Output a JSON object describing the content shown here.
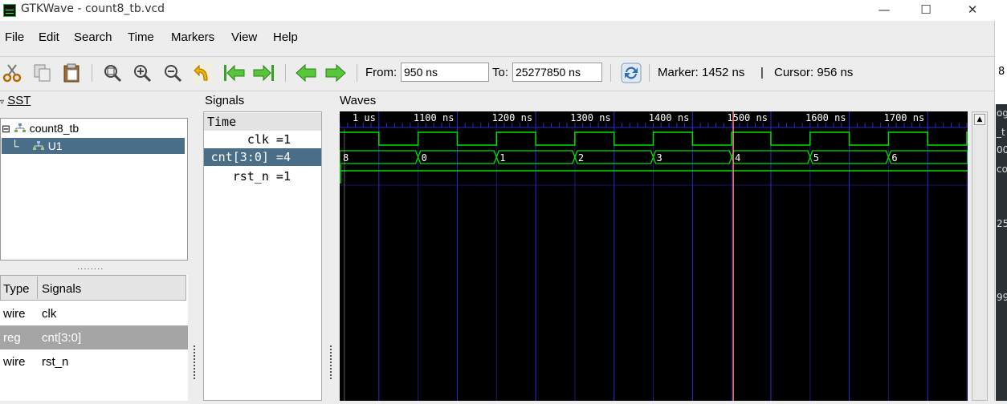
{
  "window": {
    "title": "GTKWave - count8_tb.vcd",
    "minimize": "—",
    "maximize": "☐",
    "close": "✕"
  },
  "menu": [
    "File",
    "Edit",
    "Search",
    "Time",
    "Markers",
    "View",
    "Help"
  ],
  "toolbar": {
    "from_label": "From:",
    "from_value": "950 ns",
    "to_label": "To:",
    "to_value": "25277850 ns",
    "marker_text": "Marker: 1452 ns",
    "sep_text": "|",
    "cursor_text": "Cursor: 956 ns"
  },
  "sst": {
    "label": "SST",
    "tree": [
      {
        "toggle": "⊟",
        "label": "count8_tb"
      },
      {
        "label": "U1"
      }
    ],
    "grip": "........",
    "columns": {
      "type": "Type",
      "signals": "Signals"
    },
    "rows": [
      {
        "type": "wire",
        "name": "clk"
      },
      {
        "type": "reg",
        "name": "cnt[3:0]"
      },
      {
        "type": "wire",
        "name": "rst_n"
      }
    ]
  },
  "signals": {
    "label": "Signals",
    "time_header": "Time",
    "rows": [
      "clk =1",
      "cnt[3:0] =4",
      "rst_n =1"
    ]
  },
  "waves": {
    "label": "Waves",
    "ticks": [
      {
        "t": 1000,
        "label": "1 us"
      },
      {
        "t": 1100,
        "label": "1100 ns"
      },
      {
        "t": 1200,
        "label": "1200 ns"
      },
      {
        "t": 1300,
        "label": "1300 ns"
      },
      {
        "t": 1400,
        "label": "1400 ns"
      },
      {
        "t": 1500,
        "label": "1500 ns"
      },
      {
        "t": 1600,
        "label": "1600 ns"
      },
      {
        "t": 1700,
        "label": "1700 ns"
      }
    ],
    "view_start_ns": 950,
    "view_end_ns": 1751,
    "clock_period_ns": 100,
    "clock_rise_offset_ns": 50,
    "cnt_segments": [
      {
        "from": 950,
        "to": 1050,
        "value": "8"
      },
      {
        "from": 1050,
        "to": 1150,
        "value": "0"
      },
      {
        "from": 1150,
        "to": 1250,
        "value": "1"
      },
      {
        "from": 1250,
        "to": 1350,
        "value": "2"
      },
      {
        "from": 1350,
        "to": 1450,
        "value": "3"
      },
      {
        "from": 1450,
        "to": 1550,
        "value": "4"
      },
      {
        "from": 1550,
        "to": 1650,
        "value": "5"
      },
      {
        "from": 1650,
        "to": 1751,
        "value": "6"
      }
    ],
    "marker_ns": 1452,
    "cursor_ns": 956,
    "colors": {
      "wave": "#00e000",
      "grid": "#2a2ad0",
      "marker": "#ff8080",
      "cursor": "#ffffff",
      "text": "#ffffff"
    }
  },
  "right_strip_chars": [
    "8",
    "og",
    "_t",
    "00",
    "co",
    "25",
    "99"
  ]
}
